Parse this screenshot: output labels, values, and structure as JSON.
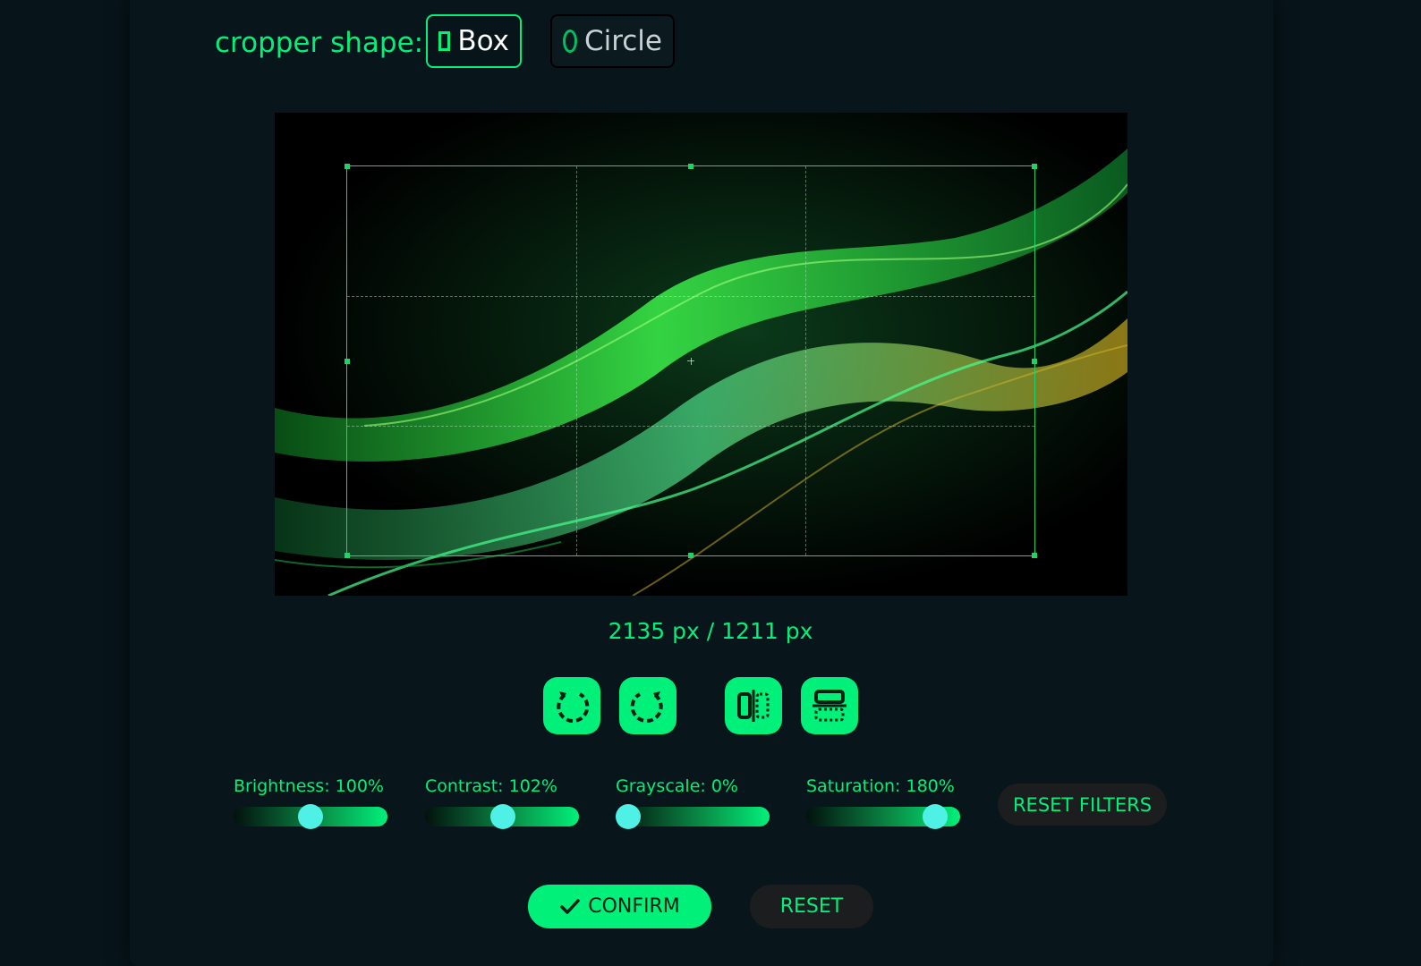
{
  "cropper": {
    "label": "cropper shape:",
    "options": [
      {
        "label": "Box",
        "icon": "square-icon",
        "selected": true
      },
      {
        "label": "Circle",
        "icon": "circle-icon",
        "selected": false
      }
    ]
  },
  "image": {
    "description_icon": "abstract-green-waves-image"
  },
  "dimensions": "2135 px / 1211 px",
  "tools": [
    {
      "name": "rotate-left",
      "icon": "rotate-left-icon"
    },
    {
      "name": "rotate-right",
      "icon": "rotate-right-icon"
    },
    {
      "name": "flip-horizontal",
      "icon": "flip-horizontal-icon"
    },
    {
      "name": "flip-vertical",
      "icon": "flip-vertical-icon"
    }
  ],
  "filters": [
    {
      "label": "Brightness: 100%",
      "fraction": 0.5
    },
    {
      "label": "Contrast: 102%",
      "fraction": 0.51
    },
    {
      "label": "Grayscale: 0%",
      "fraction": 0.0
    },
    {
      "label": "Saturation: 180%",
      "fraction": 0.9
    }
  ],
  "buttons": {
    "reset_filters": "RESET FILTERS",
    "confirm": "CONFIRM",
    "reset": "RESET"
  },
  "colors": {
    "accent": "#00f07a",
    "thumb": "#4ff1e6",
    "background": "#071419"
  }
}
